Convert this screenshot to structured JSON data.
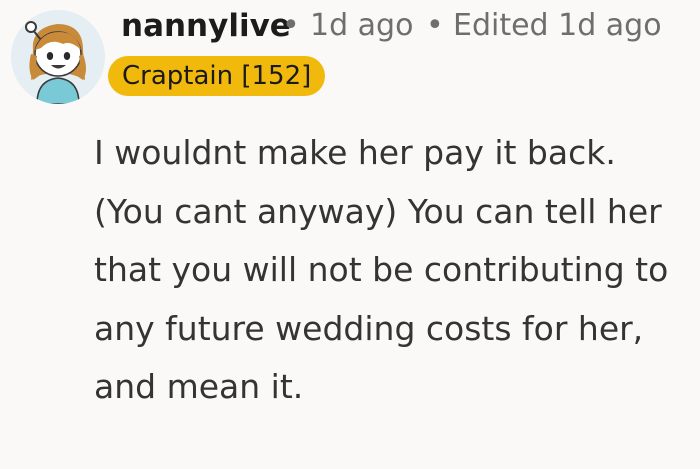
{
  "comment": {
    "author": "nannylive",
    "separator": "•",
    "posted_time": "1d ago",
    "edited_label": "Edited 1d ago",
    "flair": "Craptain [152]",
    "flair_color": "#f1b90c",
    "avatar_icon": "cartoon-girl-avatar-icon",
    "body": "I wouldnt make her pay it back. (You cant anyway) You can tell her that you will not be contributing to any future wedding costs for her, and mean it."
  },
  "colors": {
    "background": "#fbf9f8",
    "author": "#1c1c1c",
    "meta": "#6e6e6e",
    "body_text": "#343434"
  }
}
